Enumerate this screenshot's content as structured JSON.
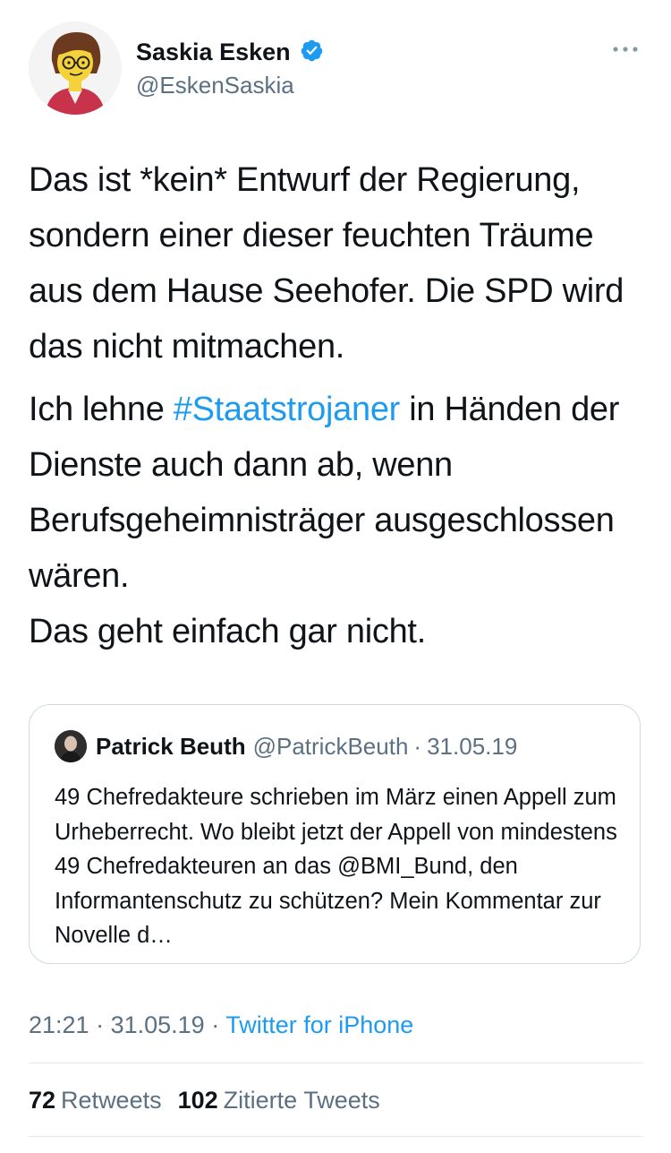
{
  "author": {
    "display_name": "Saskia Esken",
    "handle": "@EskenSaskia",
    "verified": true,
    "avatar": "cartoon-avatar-icon"
  },
  "tweet": {
    "paragraph1": "Das ist *kein* Entwurf der Regierung, sondern einer dieser feuchten Träume aus dem Hause Seehofer. Die SPD wird das nicht mitmachen.",
    "paragraph2_prefix": "Ich lehne ",
    "hashtag": "#Staatstrojaner",
    "paragraph2_suffix": " in Händen der Dienste auch dann ab, wenn Berufsgeheimnisträger ausgeschlossen wären.",
    "paragraph3": "Das geht einfach gar nicht."
  },
  "quoted_tweet": {
    "display_name": "Patrick Beuth",
    "handle": "@PatrickBeuth",
    "separator": "·",
    "date": "31.05.19",
    "text": "49 Chefredakteure schrieben im März einen Appell zum Urheberrecht. Wo bleibt jetzt der Appell von mindestens 49 Chefredakteuren an das @BMI_Bund, den Informantenschutz zu schützen? Mein Kommentar zur Novelle d…"
  },
  "meta": {
    "time": "21:21",
    "sep1": " · ",
    "date": "31.05.19",
    "sep2": " · ",
    "source": "Twitter for iPhone"
  },
  "stats": {
    "retweets_count": "72",
    "retweets_label": "Retweets",
    "quotes_count": "102",
    "quotes_label": "Zitierte Tweets"
  },
  "colors": {
    "link": "#1d9bf0",
    "secondary": "#5b7083",
    "text": "#0f1419",
    "border": "#cfd9de"
  }
}
